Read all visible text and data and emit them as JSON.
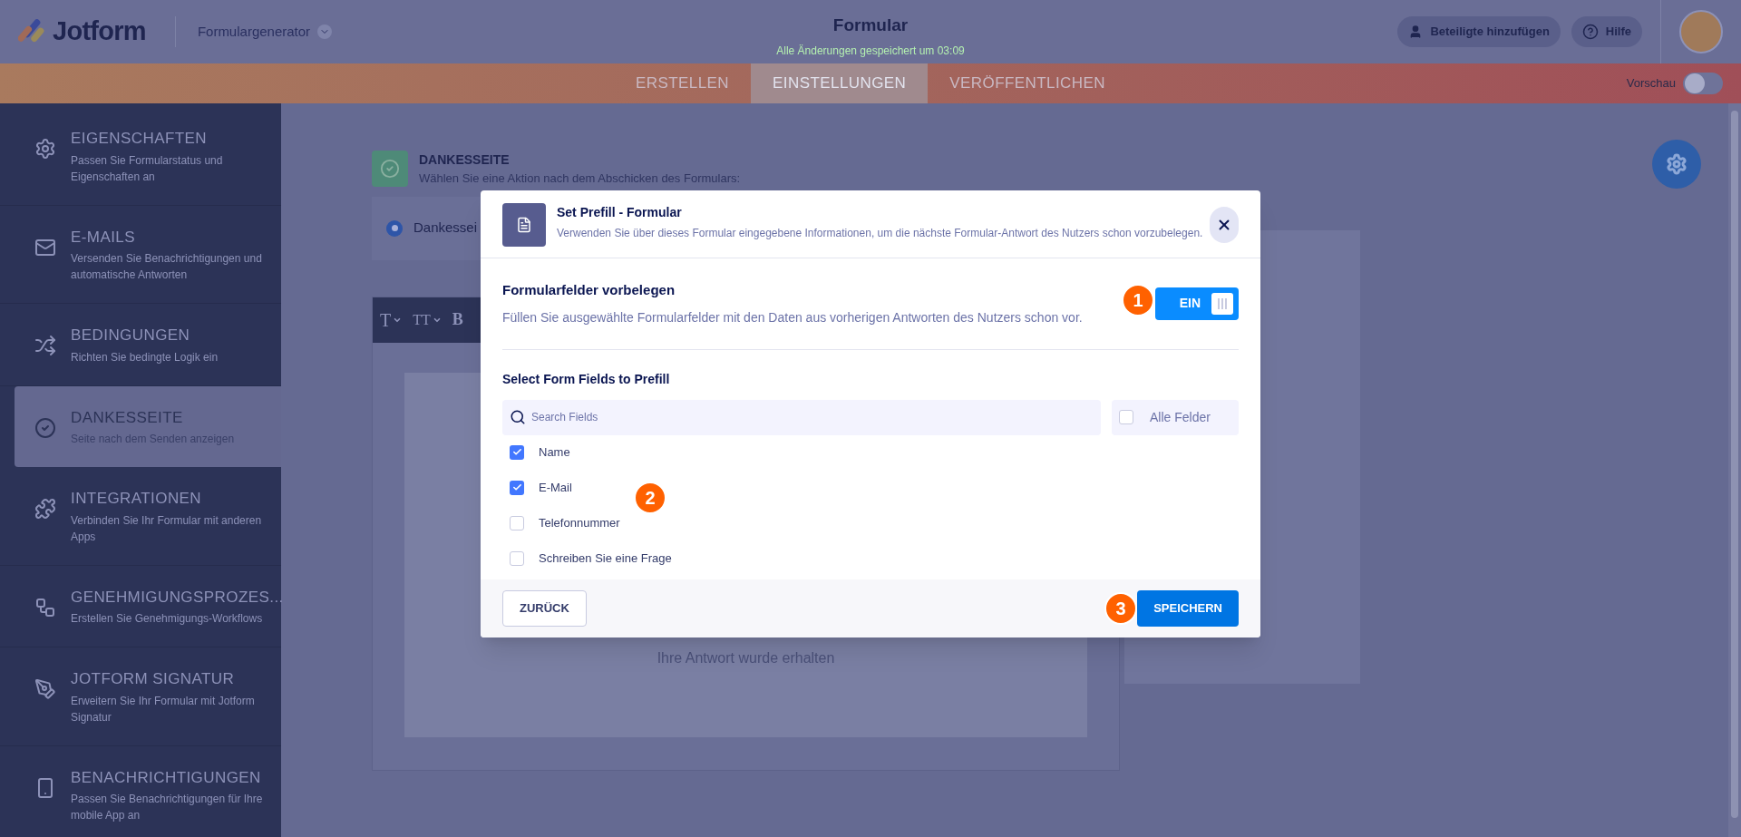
{
  "header": {
    "logo": "Jotform",
    "product": "Formulargenerator",
    "title": "Formular",
    "subtitle": "Alle Änderungen gespeichert um 03:09",
    "buttons": [
      {
        "kind": "person",
        "label": "Beteiligte hinzufügen"
      },
      {
        "kind": "help",
        "label": "Hilfe"
      }
    ]
  },
  "tabs": [
    {
      "label": "ERSTELLEN",
      "selected": false
    },
    {
      "label": "EINSTELLUNGEN",
      "selected": true
    },
    {
      "label": "VERÖFFENTLICHEN",
      "selected": false
    }
  ],
  "preview": {
    "label": "Vorschau",
    "on": false
  },
  "sidebar": {
    "items": [
      {
        "kind": "gear",
        "title": "EIGENSCHAFTEN",
        "description": "Passen Sie Formularstatus und Eigenschaften an",
        "selected": false
      },
      {
        "kind": "mail",
        "title": "E-MAILS",
        "description": "Versenden Sie Benachrichtigungen und automatische Antworten",
        "selected": false
      },
      {
        "kind": "shuffle",
        "title": "BEDINGUNGEN",
        "description": "Richten Sie bedingte Logik ein",
        "selected": false
      },
      {
        "kind": "check",
        "title": "DANKESSEITE",
        "description": "Seite nach dem Senden anzeigen",
        "selected": true
      },
      {
        "kind": "puzzle",
        "title": "INTEGRATIONEN",
        "description": "Verbinden Sie Ihr Formular mit anderen Apps",
        "selected": false
      },
      {
        "kind": "workflow",
        "title": "GENEHMIGUNGSPROZES...",
        "description": "Erstellen Sie Genehmigungs-Workflows",
        "selected": false
      },
      {
        "kind": "pen",
        "title": "JOTFORM SIGNATUR",
        "description": "Erweitern Sie Ihr Formular mit Jotform Signatur",
        "selected": false
      },
      {
        "kind": "phone",
        "title": "BENACHRICHTIGUNGEN",
        "description": "Passen Sie Benachrichtigungen für Ihre mobile App an",
        "selected": false
      }
    ]
  },
  "page": {
    "section_title": "DANKESSEITE",
    "section_subtitle": "Wählen Sie eine Aktion nach dem Abschicken des Formulars:",
    "option": {
      "label": "Dankessei",
      "selected": true
    },
    "editor": {
      "toolbar": [
        {
          "kind": "font",
          "label": "T"
        },
        {
          "kind": "size",
          "label": "TT"
        },
        {
          "kind": "bold",
          "label": "B"
        }
      ],
      "message": "Ihre Antwort wurde erhalten"
    }
  },
  "dialog": {
    "title": "Set Prefill - Formular",
    "description": "Verwenden Sie über dieses Formular eingegebene Informationen, um die nächste Formular-Antwort des Nutzers schon vorzubelegen.",
    "prefill": {
      "title": "Formularfelder vorbelegen",
      "description": "Füllen Sie ausgewählte Formularfelder mit den Daten aus vorherigen Antworten des Nutzers schon vor.",
      "toggle_label": "EIN",
      "on": true,
      "marker": "1"
    },
    "fields_title": "Select Form Fields to Prefill",
    "search": {
      "placeholder": "Search Fields"
    },
    "all_fields": {
      "label": "Alle Felder",
      "checked": false
    },
    "fields_marker": "2",
    "fields": [
      {
        "label": "Name",
        "checked": true
      },
      {
        "label": "E-Mail",
        "checked": true
      },
      {
        "label": "Telefonnummer",
        "checked": false
      },
      {
        "label": "Schreiben Sie eine Frage",
        "checked": false
      }
    ],
    "back_button": "ZURÜCK",
    "save_button": "SPEICHERN",
    "save_marker": "3"
  }
}
